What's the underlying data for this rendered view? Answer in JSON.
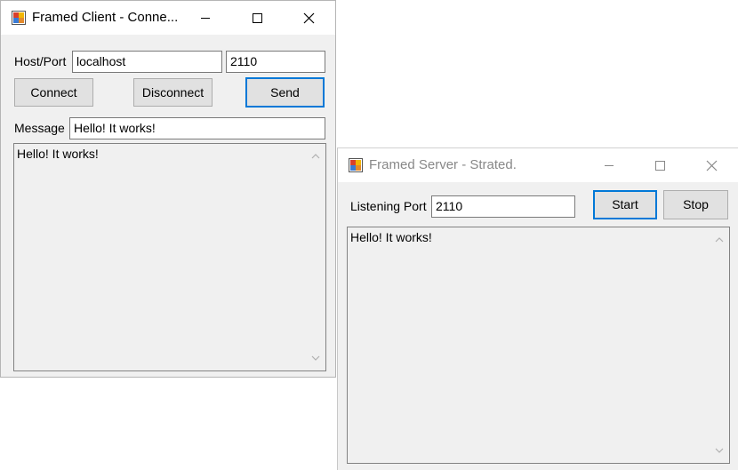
{
  "client": {
    "title": "Framed Client - Conne...",
    "host_port_label": "Host/Port",
    "host_value": "localhost",
    "port_value": "2110",
    "connect_label": "Connect",
    "disconnect_label": "Disconnect",
    "send_label": "Send",
    "message_label": "Message",
    "message_value": "Hello! It works!",
    "log_text": "Hello! It works!"
  },
  "server": {
    "title": "Framed Server - Strated.",
    "listening_port_label": "Listening Port",
    "port_value": "2110",
    "start_label": "Start",
    "stop_label": "Stop",
    "log_text": "Hello! It works!"
  },
  "icons": {
    "app": "app-window-icon",
    "minimize": "minimize-icon",
    "maximize": "maximize-icon",
    "close": "close-icon",
    "scroll_up": "chevron-up-icon",
    "scroll_down": "chevron-down-icon"
  },
  "colors": {
    "focus_border": "#0078d7",
    "window_bg": "#f0f0f0",
    "button_bg": "#e1e1e1"
  }
}
